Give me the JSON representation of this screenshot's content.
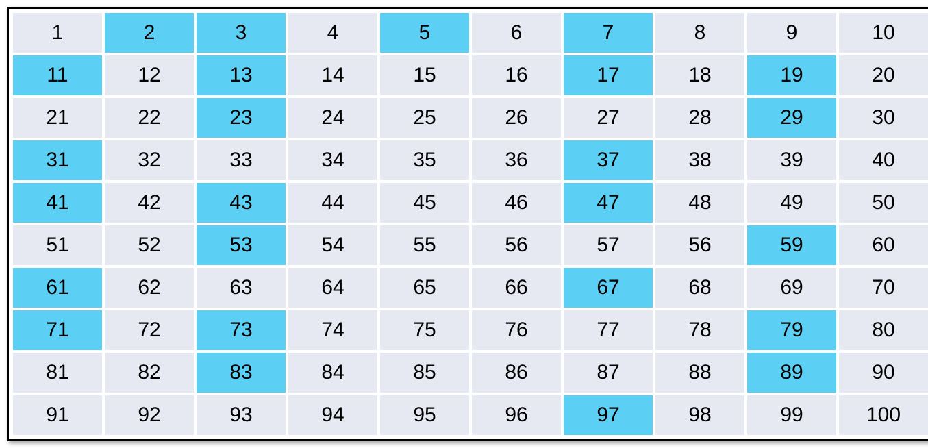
{
  "grid": {
    "rows": [
      [
        {
          "v": "1",
          "h": false
        },
        {
          "v": "2",
          "h": true
        },
        {
          "v": "3",
          "h": true
        },
        {
          "v": "4",
          "h": false
        },
        {
          "v": "5",
          "h": true
        },
        {
          "v": "6",
          "h": false
        },
        {
          "v": "7",
          "h": true
        },
        {
          "v": "8",
          "h": false
        },
        {
          "v": "9",
          "h": false
        },
        {
          "v": "10",
          "h": false
        }
      ],
      [
        {
          "v": "11",
          "h": true
        },
        {
          "v": "12",
          "h": false
        },
        {
          "v": "13",
          "h": true
        },
        {
          "v": "14",
          "h": false
        },
        {
          "v": "15",
          "h": false
        },
        {
          "v": "16",
          "h": false
        },
        {
          "v": "17",
          "h": true
        },
        {
          "v": "18",
          "h": false
        },
        {
          "v": "19",
          "h": true
        },
        {
          "v": "20",
          "h": false
        }
      ],
      [
        {
          "v": "21",
          "h": false
        },
        {
          "v": "22",
          "h": false
        },
        {
          "v": "23",
          "h": true
        },
        {
          "v": "24",
          "h": false
        },
        {
          "v": "25",
          "h": false
        },
        {
          "v": "26",
          "h": false
        },
        {
          "v": "27",
          "h": false
        },
        {
          "v": "28",
          "h": false
        },
        {
          "v": "29",
          "h": true
        },
        {
          "v": "30",
          "h": false
        }
      ],
      [
        {
          "v": "31",
          "h": true
        },
        {
          "v": "32",
          "h": false
        },
        {
          "v": "33",
          "h": false
        },
        {
          "v": "34",
          "h": false
        },
        {
          "v": "35",
          "h": false
        },
        {
          "v": "36",
          "h": false
        },
        {
          "v": "37",
          "h": true
        },
        {
          "v": "38",
          "h": false
        },
        {
          "v": "39",
          "h": false
        },
        {
          "v": "40",
          "h": false
        }
      ],
      [
        {
          "v": "41",
          "h": true
        },
        {
          "v": "42",
          "h": false
        },
        {
          "v": "43",
          "h": true
        },
        {
          "v": "44",
          "h": false
        },
        {
          "v": "45",
          "h": false
        },
        {
          "v": "46",
          "h": false
        },
        {
          "v": "47",
          "h": true
        },
        {
          "v": "48",
          "h": false
        },
        {
          "v": "49",
          "h": false
        },
        {
          "v": "50",
          "h": false
        }
      ],
      [
        {
          "v": "51",
          "h": false
        },
        {
          "v": "52",
          "h": false
        },
        {
          "v": "53",
          "h": true
        },
        {
          "v": "54",
          "h": false
        },
        {
          "v": "55",
          "h": false
        },
        {
          "v": "56",
          "h": false
        },
        {
          "v": "57",
          "h": false
        },
        {
          "v": "56",
          "h": false
        },
        {
          "v": "59",
          "h": true
        },
        {
          "v": "60",
          "h": false
        }
      ],
      [
        {
          "v": "61",
          "h": true
        },
        {
          "v": "62",
          "h": false
        },
        {
          "v": "63",
          "h": false
        },
        {
          "v": "64",
          "h": false
        },
        {
          "v": "65",
          "h": false
        },
        {
          "v": "66",
          "h": false
        },
        {
          "v": "67",
          "h": true
        },
        {
          "v": "68",
          "h": false
        },
        {
          "v": "69",
          "h": false
        },
        {
          "v": "70",
          "h": false
        }
      ],
      [
        {
          "v": "71",
          "h": true
        },
        {
          "v": "72",
          "h": false
        },
        {
          "v": "73",
          "h": true
        },
        {
          "v": "74",
          "h": false
        },
        {
          "v": "75",
          "h": false
        },
        {
          "v": "76",
          "h": false
        },
        {
          "v": "77",
          "h": false
        },
        {
          "v": "78",
          "h": false
        },
        {
          "v": "79",
          "h": true
        },
        {
          "v": "80",
          "h": false
        }
      ],
      [
        {
          "v": "81",
          "h": false
        },
        {
          "v": "82",
          "h": false
        },
        {
          "v": "83",
          "h": true
        },
        {
          "v": "84",
          "h": false
        },
        {
          "v": "85",
          "h": false
        },
        {
          "v": "86",
          "h": false
        },
        {
          "v": "87",
          "h": false
        },
        {
          "v": "88",
          "h": false
        },
        {
          "v": "89",
          "h": true
        },
        {
          "v": "90",
          "h": false
        }
      ],
      [
        {
          "v": "91",
          "h": false
        },
        {
          "v": "92",
          "h": false
        },
        {
          "v": "93",
          "h": false
        },
        {
          "v": "94",
          "h": false
        },
        {
          "v": "95",
          "h": false
        },
        {
          "v": "96",
          "h": false
        },
        {
          "v": "97",
          "h": true
        },
        {
          "v": "98",
          "h": false
        },
        {
          "v": "99",
          "h": false
        },
        {
          "v": "100",
          "h": false
        }
      ]
    ]
  },
  "chart_data": {
    "type": "table",
    "title": "",
    "columns": 10,
    "rows": 10,
    "values": [
      [
        1,
        2,
        3,
        4,
        5,
        6,
        7,
        8,
        9,
        10
      ],
      [
        11,
        12,
        13,
        14,
        15,
        16,
        17,
        18,
        19,
        20
      ],
      [
        21,
        22,
        23,
        24,
        25,
        26,
        27,
        28,
        29,
        30
      ],
      [
        31,
        32,
        33,
        34,
        35,
        36,
        37,
        38,
        39,
        40
      ],
      [
        41,
        42,
        43,
        44,
        45,
        46,
        47,
        48,
        49,
        50
      ],
      [
        51,
        52,
        53,
        54,
        55,
        56,
        57,
        56,
        59,
        60
      ],
      [
        61,
        62,
        63,
        64,
        65,
        66,
        67,
        68,
        69,
        70
      ],
      [
        71,
        72,
        73,
        74,
        75,
        76,
        77,
        78,
        79,
        80
      ],
      [
        81,
        82,
        83,
        84,
        85,
        86,
        87,
        88,
        89,
        90
      ],
      [
        91,
        92,
        93,
        94,
        95,
        96,
        97,
        98,
        99,
        100
      ]
    ],
    "highlighted": [
      2,
      3,
      5,
      7,
      11,
      13,
      17,
      19,
      23,
      29,
      31,
      37,
      41,
      43,
      47,
      53,
      59,
      61,
      67,
      71,
      73,
      79,
      83,
      89,
      97
    ]
  }
}
